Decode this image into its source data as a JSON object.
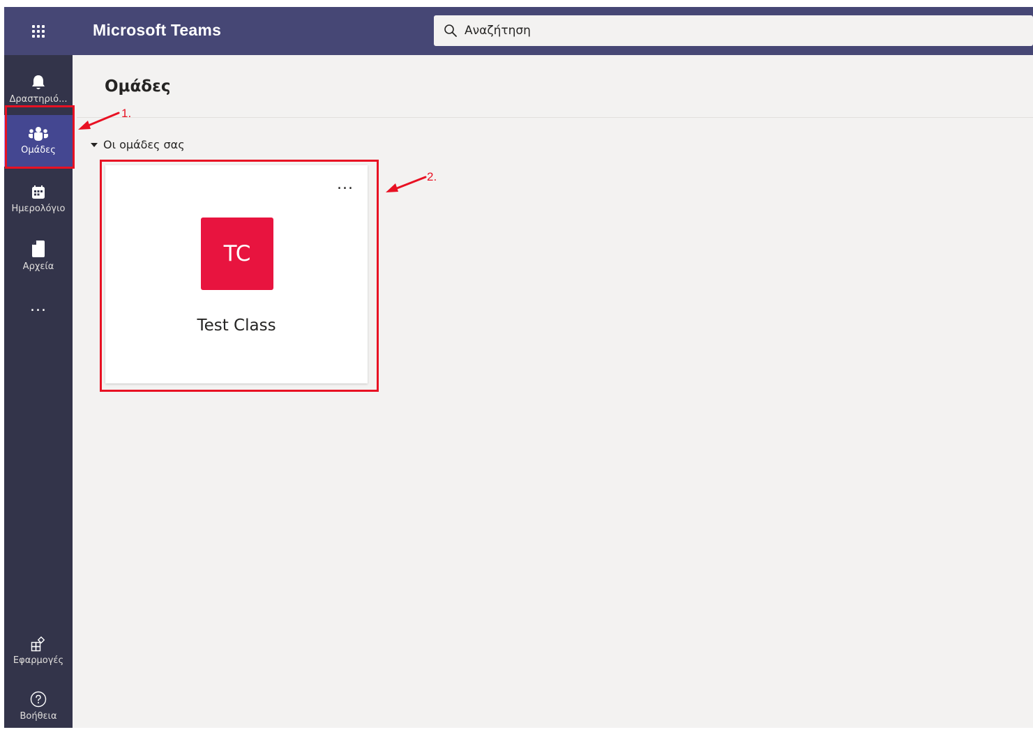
{
  "topbar": {
    "app_title": "Microsoft Teams",
    "search_placeholder": "Αναζήτηση"
  },
  "rail": {
    "items": [
      {
        "label": "Δραστηριό...",
        "icon": "bell-icon"
      },
      {
        "label": "Ομάδες",
        "icon": "teams-icon",
        "active": true
      },
      {
        "label": "Ημερολόγιο",
        "icon": "calendar-icon"
      },
      {
        "label": "Αρχεία",
        "icon": "file-icon"
      }
    ],
    "more": "...",
    "bottom": [
      {
        "label": "Εφαρμογές",
        "icon": "apps-icon"
      },
      {
        "label": "Βοήθεια",
        "icon": "help-icon"
      }
    ]
  },
  "main": {
    "title": "Ομάδες",
    "section_label": "Οι ομάδες σας",
    "teams": [
      {
        "initials": "TC",
        "name": "Test Class",
        "color": "#e8143f",
        "more": "..."
      }
    ]
  },
  "annotations": {
    "step1": "1.",
    "step2": "2.",
    "color": "#e81123"
  },
  "colors": {
    "topbar": "#464775",
    "rail": "#33344a",
    "background": "#f3f2f1",
    "active_item": "#444791"
  }
}
